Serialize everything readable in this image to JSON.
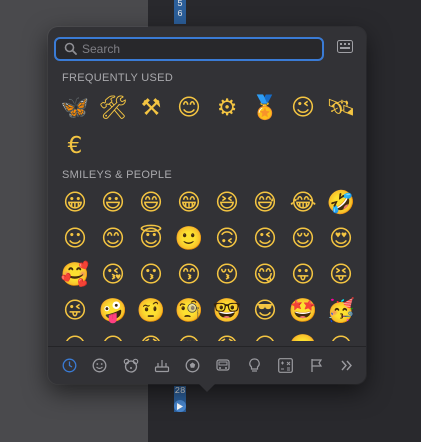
{
  "editor": {
    "gutter_top_line_a": "5",
    "gutter_top_line_b": "6",
    "gutter_bottom_line": "28"
  },
  "picker": {
    "search": {
      "placeholder": "Search",
      "value": ""
    },
    "sections": {
      "frequently_used": {
        "title": "FREQUENTLY USED",
        "emojis": [
          "🦋",
          "🛠",
          "⚒",
          "😊",
          "⚙",
          "🏅",
          "😉",
          "🛰",
          "€"
        ]
      },
      "smileys_people": {
        "title": "SMILEYS & PEOPLE",
        "emojis": [
          "😀",
          "😃",
          "😄",
          "😁",
          "😆",
          "😅",
          "😂",
          "🤣",
          "☺",
          "😊",
          "😇",
          "🙂",
          "🙃",
          "😉",
          "😌",
          "😍",
          "🥰",
          "😘",
          "😗",
          "😙",
          "😚",
          "😋",
          "😛",
          "😝",
          "😜",
          "🤪",
          "🤨",
          "🧐",
          "🤓",
          "😎",
          "🤩",
          "🥳",
          "😏",
          "😒",
          "😞",
          "😔",
          "😟",
          "😕",
          "🙁",
          "☹"
        ]
      }
    },
    "tabs": [
      {
        "name": "recent",
        "icon": "clock-icon",
        "active": true
      },
      {
        "name": "smileys",
        "icon": "smiley-icon"
      },
      {
        "name": "animals",
        "icon": "bear-icon"
      },
      {
        "name": "food",
        "icon": "food-icon"
      },
      {
        "name": "activity",
        "icon": "ball-icon"
      },
      {
        "name": "travel",
        "icon": "car-icon"
      },
      {
        "name": "objects",
        "icon": "bulb-icon"
      },
      {
        "name": "symbols",
        "icon": "symbols-icon"
      },
      {
        "name": "flags",
        "icon": "flag-icon"
      },
      {
        "name": "more",
        "icon": "chevrons-right-icon"
      }
    ],
    "colors": {
      "accent": "#3a7bd5",
      "panel": "#323236",
      "text_muted": "#a9a9ad"
    }
  }
}
